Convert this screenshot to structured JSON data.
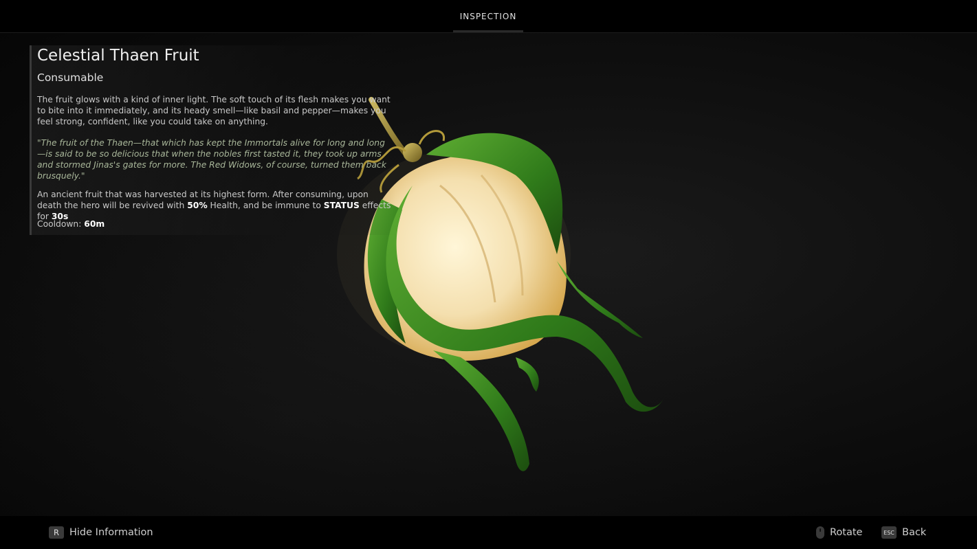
{
  "header": {
    "tab_label": "INSPECTION"
  },
  "item": {
    "name": "Celestial Thaen Fruit",
    "type": "Consumable",
    "description": "The fruit glows with a kind of inner light. The soft touch of its flesh makes you want to bite into it immediately, and its heady smell—like basil and pepper—makes you feel strong, confident, like you could take on anything.",
    "quote": "\"The fruit of the Thaen—that which has kept the Immortals alive for long and long—is said to be so delicious that when the nobles first tasted it, they took up arms and stormed Jinas's gates for more. The Red Widows, of course, turned them back brusquely.\"",
    "effect": {
      "part1": "An ancient fruit that was harvested at its highest form. After consuming, upon death the hero will be revived with ",
      "health_value": "50%",
      "part2": " Health, and be immune to ",
      "status_word": "STATUS",
      "part3": " effects for ",
      "duration": "30s"
    },
    "cooldown_label": "Cooldown: ",
    "cooldown_value": "60m"
  },
  "footer": {
    "hide_key": "R",
    "hide_label": "Hide Information",
    "rotate_icon": "mouse-icon",
    "rotate_label": "Rotate",
    "back_key": "ESC",
    "back_label": "Back"
  },
  "colors": {
    "background": "#0b0b0b",
    "quote_text": "#a9b79a",
    "fruit_leaf": "#3f8f22",
    "fruit_flesh": "#f2ddb0"
  }
}
